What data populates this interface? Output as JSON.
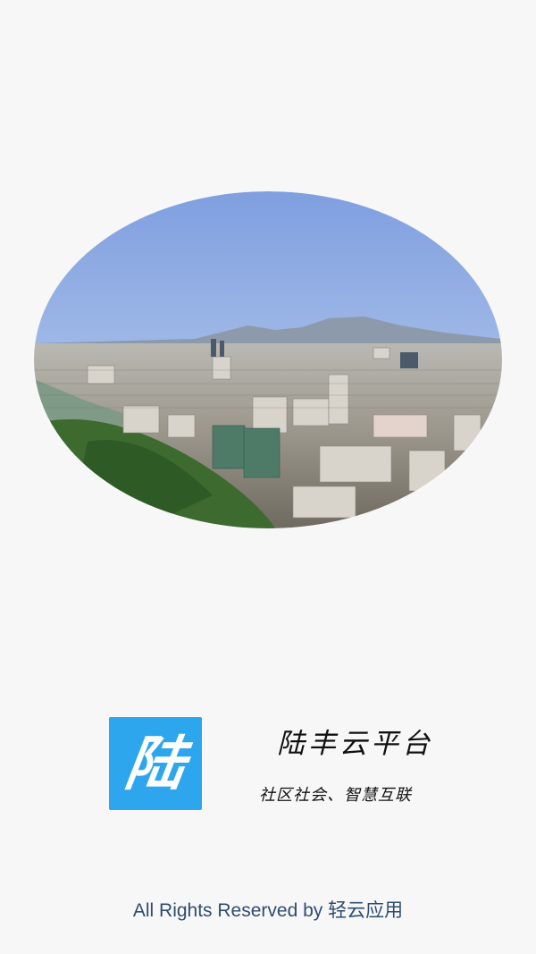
{
  "splash": {
    "image_name": "city-skyline-photo",
    "logo_char": "陆",
    "logo_color": "#2ea6ee",
    "brand_title": "陆丰云平台",
    "brand_slogan": "社区社会、智慧互联",
    "footer_text": "All Rights Reserved by 轻云应用"
  },
  "colors": {
    "background": "#f7f7f7",
    "footer_text": "#2f4c70"
  }
}
